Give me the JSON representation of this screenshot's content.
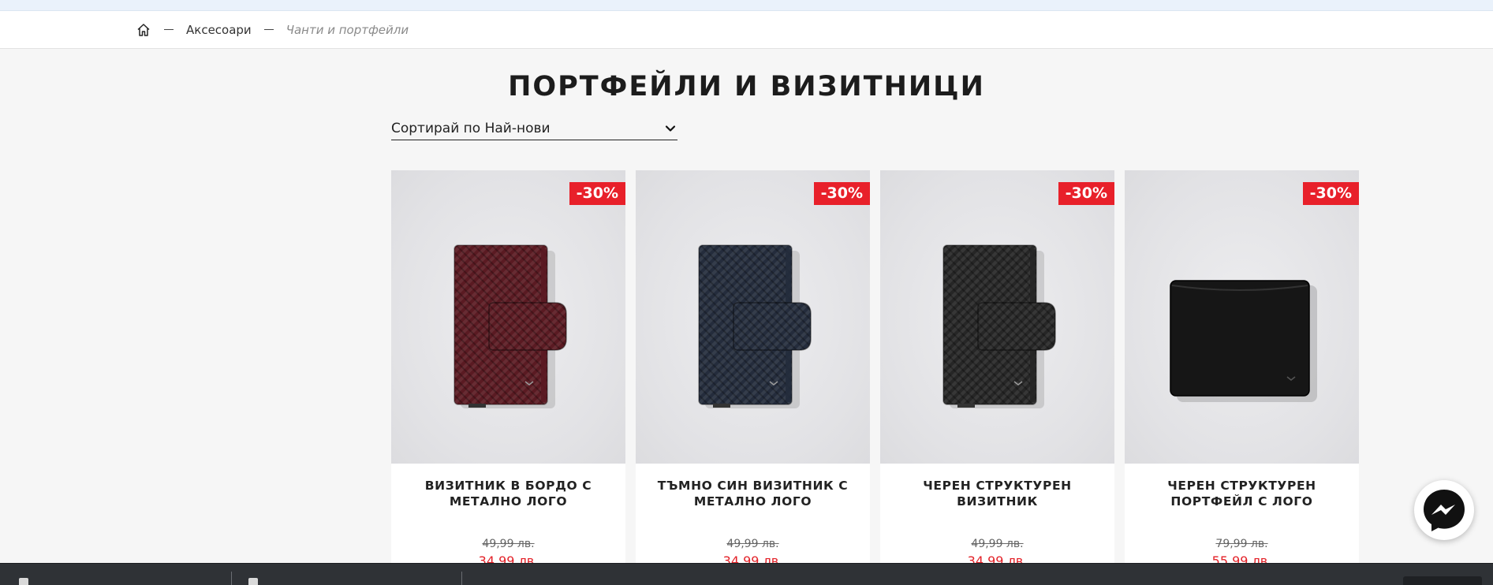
{
  "breadcrumb": {
    "home_icon": "home-icon",
    "items": [
      "Аксесоари"
    ],
    "current": "Чанти и портфейли"
  },
  "page": {
    "title": "ПОРТФЕЙЛИ И ВИЗИТНИЦИ"
  },
  "sort": {
    "label": "Сортирай по Най-нови",
    "icon": "chevron-down-icon"
  },
  "products": [
    {
      "name": "ВИЗИТНИК В БОРДО С МЕТАЛНО ЛОГО",
      "badge": "-30%",
      "old_price": "49,99 лв.",
      "new_price": "34,99 лв.",
      "color": "#5a1a22",
      "kind": "card-holder"
    },
    {
      "name": "ТЪМНО СИН ВИЗИТНИК С МЕТАЛНО ЛОГО",
      "badge": "-30%",
      "old_price": "49,99 лв.",
      "new_price": "34,99 лв.",
      "color": "#242c3c",
      "kind": "card-holder"
    },
    {
      "name": "ЧЕРЕН СТРУКТУРЕН ВИЗИТНИК",
      "badge": "-30%",
      "old_price": "49,99 лв.",
      "new_price": "34,99 лв.",
      "color": "#262626",
      "kind": "card-holder"
    },
    {
      "name": "ЧЕРЕН СТРУКТУРЕН ПОРТФЕЙЛ С ЛОГО",
      "badge": "-30%",
      "old_price": "79,99 лв.",
      "new_price": "55,99 лв.",
      "color": "#161616",
      "kind": "wallet"
    }
  ],
  "colors": {
    "badge": "#e8202a",
    "sale_price": "#e32027",
    "background": "#f6f6f6"
  },
  "widgets": {
    "messenger_icon": "messenger-icon"
  }
}
